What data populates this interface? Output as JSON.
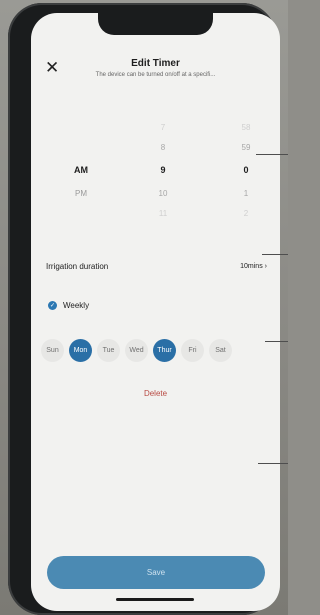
{
  "header": {
    "close_icon": "close-icon",
    "title": "Edit Timer",
    "subtitle": "The device can be turned on/off at a specifi..."
  },
  "time_picker": {
    "ampm": {
      "selected": "AM",
      "next": "PM"
    },
    "hours": {
      "far_above": "7",
      "above": "8",
      "selected": "9",
      "below": "10",
      "far_below": "11"
    },
    "minutes": {
      "far_above": "58",
      "above": "59",
      "selected": "0",
      "below": "1",
      "far_below": "2"
    }
  },
  "irrigation": {
    "label": "Irrigation duration",
    "value": "10mins",
    "chevron_icon": "chevron-right-icon"
  },
  "repeat": {
    "label": "Weekly",
    "checked": true
  },
  "days": [
    {
      "label": "Sun",
      "selected": false
    },
    {
      "label": "Mon",
      "selected": true
    },
    {
      "label": "Tue",
      "selected": false
    },
    {
      "label": "Wed",
      "selected": false
    },
    {
      "label": "Thur",
      "selected": true
    },
    {
      "label": "Fri",
      "selected": false
    },
    {
      "label": "Sat",
      "selected": false
    }
  ],
  "delete_label": "Delete",
  "save_label": "Save",
  "colors": {
    "accent": "#2a6fa6",
    "save_button": "#4b8ab3",
    "delete": "#b84b43"
  }
}
